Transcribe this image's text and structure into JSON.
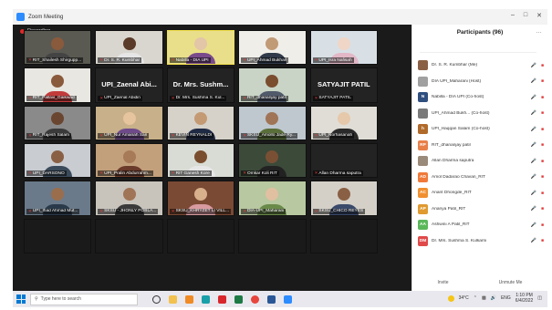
{
  "window": {
    "title": "Zoom Meeting"
  },
  "meeting": {
    "recording_label": "Recording"
  },
  "tiles": [
    {
      "name": "RIT_Shailesh Shirgupp...",
      "big": "",
      "bg": "#5a5a52",
      "skin": "#8a5a3c",
      "shirt": "#444"
    },
    {
      "name": "Dr. S. R. Kumbhar",
      "big": "",
      "bg": "#d9d6cf",
      "skin": "#5a3a28",
      "shirt": "#e6e6e6"
    },
    {
      "name": "Nabilla - DIA UPI",
      "big": "",
      "bg": "#e9df8a",
      "skin": "#e3c5a7",
      "shirt": "#7a4b8c",
      "active": true
    },
    {
      "name": "UPI_Ahmad Bukhari",
      "big": "",
      "bg": "#f0eee9",
      "skin": "#c19a76",
      "shirt": "#303a4a"
    },
    {
      "name": "UPI_Isra Nafisah",
      "big": "",
      "bg": "#d8e0e6",
      "skin": "#f0d6c6",
      "shirt": "#e2b8c6"
    },
    {
      "name": "RIT_Pallavi_Gaikwad",
      "big": "",
      "bg": "#e9e7e1",
      "skin": "#8a5a3c",
      "shirt": "#c23b3b"
    },
    {
      "name": "UPI_Zaenal Abidin",
      "big": "UPI_Zaenal Abi...",
      "bg": "#232323",
      "skin": "",
      "shirt": ""
    },
    {
      "name": "Dr. Mrs. Sushma S. Kul...",
      "big": "Dr. Mrs. Sushm...",
      "bg": "#232323",
      "skin": "",
      "shirt": ""
    },
    {
      "name": "RIT_dhananjay patil",
      "big": "",
      "bg": "#c9d4c6",
      "skin": "#7a4d2e",
      "shirt": "#505a6a"
    },
    {
      "name": "SATYAJIT PATIL",
      "big": "SATYAJIT PATIL",
      "bg": "#232323",
      "skin": "",
      "shirt": ""
    },
    {
      "name": "RIT_Rajesh Salam",
      "big": "",
      "bg": "#8a8a8a",
      "skin": "#6a4530",
      "shirt": "#3a3a3a"
    },
    {
      "name": "UPI_Nur Amanah Sari",
      "big": "",
      "bg": "#c8b08a",
      "skin": "#e6c49e",
      "shirt": "#6e4a8a"
    },
    {
      "name": "KEVIN REYNALDI",
      "big": "",
      "bg": "#d6d2ca",
      "skin": "#c49a74",
      "shirt": "#1f2a44"
    },
    {
      "name": "SKSU_Amollo Jade Ry...",
      "big": "",
      "bg": "#bfc7cf",
      "skin": "#a07456",
      "shirt": "#5a6e3a"
    },
    {
      "name": "UPI_Norhasanah",
      "big": "",
      "bg": "#e0ddd6",
      "skin": "#e6c8aa",
      "shirt": "#2a2a2a"
    },
    {
      "name": "UPI_DARSONO",
      "big": "",
      "bg": "#c9cdd2",
      "skin": "#8a6044",
      "shirt": "#3a4a5a"
    },
    {
      "name": "UPI_Pralin Abdurrahm...",
      "big": "",
      "bg": "#c2a07c",
      "skin": "#a77a58",
      "shirt": "#6a3a2a"
    },
    {
      "name": "RIT Ganesh Kore",
      "big": "",
      "bg": "#d9dcd4",
      "skin": "#7a4d2e",
      "shirt": "#e6e6e6"
    },
    {
      "name": "Omkar Koli RIT",
      "big": "",
      "bg": "#3c4a3a",
      "skin": "#7a5034",
      "shirt": "#222"
    },
    {
      "name": "Allan Dharma saputra",
      "big": "",
      "bg": "#232323",
      "skin": "",
      "shirt": ""
    },
    {
      "name": "UPI_Ihad Ahmad Mut...",
      "big": "",
      "bg": "#6a7a8a",
      "skin": "#9a6e4c",
      "shirt": "#2a3a4a"
    },
    {
      "name": "SKSU - JHONLY POBLA...",
      "big": "",
      "bg": "#c8c4bc",
      "skin": "#a07456",
      "shirt": "#3a3a3a"
    },
    {
      "name": "SKSU_KHRYZET LI VILL...",
      "big": "",
      "bg": "#7a4a34",
      "skin": "#d8b08c",
      "shirt": "#d89aa0"
    },
    {
      "name": "DIA-UPI_Maharani",
      "big": "",
      "bg": "#b8c8a0",
      "skin": "#e0c0a0",
      "shirt": "#6a8a4a"
    },
    {
      "name": "SKSU_CHICO REYES",
      "big": "",
      "bg": "#d4d0c8",
      "skin": "#8a6044",
      "shirt": "#3a4a6a"
    },
    {
      "name": "",
      "big": "",
      "bg": "#1a1a1a",
      "skin": "",
      "shirt": "",
      "empty": true
    },
    {
      "name": "",
      "big": "",
      "bg": "#1a1a1a",
      "skin": "",
      "shirt": "",
      "empty": true
    },
    {
      "name": "",
      "big": "",
      "bg": "#1a1a1a",
      "skin": "",
      "shirt": "",
      "empty": true
    },
    {
      "name": "",
      "big": "",
      "bg": "#1a1a1a",
      "skin": "",
      "shirt": "",
      "empty": true
    },
    {
      "name": "",
      "big": "",
      "bg": "#1a1a1a",
      "skin": "",
      "shirt": "",
      "empty": true
    }
  ],
  "participants_panel": {
    "title": "Participants (96)",
    "participants": [
      {
        "name": "Dr. S. R. Kumbhar (Me)",
        "initials": "",
        "color": "#8a6044"
      },
      {
        "name": "DIA UPI_Maharani (Host)",
        "initials": "",
        "color": "#a0a0a0"
      },
      {
        "name": "Nabilla - DIA UPI (Co-host)",
        "initials": "N",
        "color": "#2f4f7f"
      },
      {
        "name": "UPI_Ahmad Bukh... (Co-host)",
        "initials": "",
        "color": "#7a7a7a"
      },
      {
        "name": "UPI_Haqqan Salam (Co-host)",
        "initials": "h",
        "color": "#b06a2a"
      },
      {
        "name": "RIT_dhananjay patil",
        "initials": "RP",
        "color": "#e8804a"
      },
      {
        "name": "Allan Dharma saputra",
        "initials": "",
        "color": "#9a8a7a"
      },
      {
        "name": "Amol Dadarao Chavan_RIT",
        "initials": "AD",
        "color": "#f07a3a"
      },
      {
        "name": "Anant Dhongde_RIT",
        "initials": "AC",
        "color": "#f09030"
      },
      {
        "name": "Ananya Patil_RIT",
        "initials": "AP",
        "color": "#e09a30"
      },
      {
        "name": "Ashwini A Patil_RIT",
        "initials": "AA",
        "color": "#5ab85a"
      },
      {
        "name": "Dr. Mrs. Sushma S. Kulkarni",
        "initials": "DM",
        "color": "#e04a4a"
      }
    ],
    "footer": {
      "invite": "Invite",
      "unmute": "Unmute Me"
    }
  },
  "taskbar": {
    "search_placeholder": "Type here to search",
    "weather": "34°C",
    "lang": "ENG",
    "time": "1:10 PM",
    "date": "6/4/2022"
  }
}
